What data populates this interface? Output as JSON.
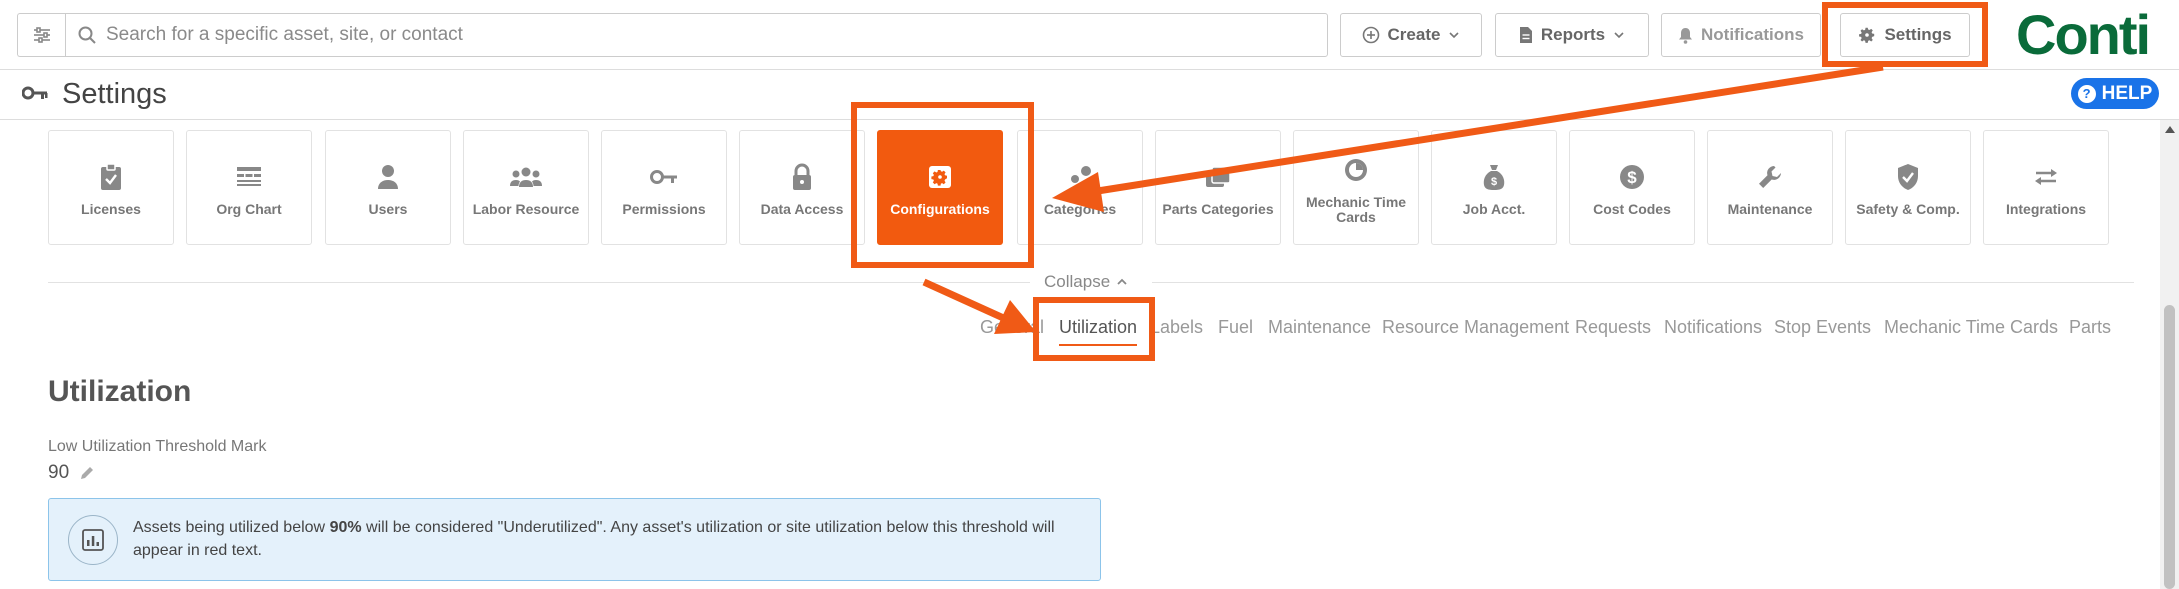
{
  "topbar": {
    "search_placeholder": "Search for a specific asset, site, or contact",
    "create_label": "Create",
    "reports_label": "Reports",
    "notifications_label": "Notifications",
    "settings_label": "Settings",
    "logo_text": "Conti"
  },
  "subbar": {
    "title": "Settings",
    "help_label": "HELP"
  },
  "tiles": [
    {
      "label": "Licenses",
      "icon": "clipboard-check-icon"
    },
    {
      "label": "Org Chart",
      "icon": "org-chart-icon"
    },
    {
      "label": "Users",
      "icon": "user-icon"
    },
    {
      "label": "Labor Resource",
      "icon": "group-icon"
    },
    {
      "label": "Permissions",
      "icon": "key-icon"
    },
    {
      "label": "Data Access",
      "icon": "lock-icon"
    },
    {
      "label": "Configurations",
      "icon": "gear-icon"
    },
    {
      "label": "Categories",
      "icon": "categories-icon"
    },
    {
      "label": "Parts Categories",
      "icon": "parts-categories-icon"
    },
    {
      "label": "Mechanic Time Cards",
      "icon": "clock-icon"
    },
    {
      "label": "Job Acct.",
      "icon": "money-bag-icon"
    },
    {
      "label": "Cost Codes",
      "icon": "dollar-icon"
    },
    {
      "label": "Maintenance",
      "icon": "wrench-icon"
    },
    {
      "label": "Safety & Comp.",
      "icon": "shield-icon"
    },
    {
      "label": "Integrations",
      "icon": "arrows-icon"
    }
  ],
  "collapse_label": "Collapse",
  "subtabs": [
    "General",
    "Utilization",
    "Labels",
    "Fuel",
    "Maintenance",
    "Resource Management",
    "Requests",
    "Notifications",
    "Stop Events",
    "Mechanic Time Cards",
    "Parts"
  ],
  "active_subtab": "Utilization",
  "section": {
    "title": "Utilization",
    "field_label": "Low Utilization Threshold Mark",
    "field_value": "90",
    "info_prefix": "Assets being utilized below ",
    "info_bold": "90%",
    "info_suffix": " will be considered \"Underutilized\". Any asset's utilization or site utilization below this threshold will appear in red text."
  },
  "colors": {
    "accent": "#f05a16",
    "logo": "#0a6b3a",
    "help": "#1a73e8"
  }
}
